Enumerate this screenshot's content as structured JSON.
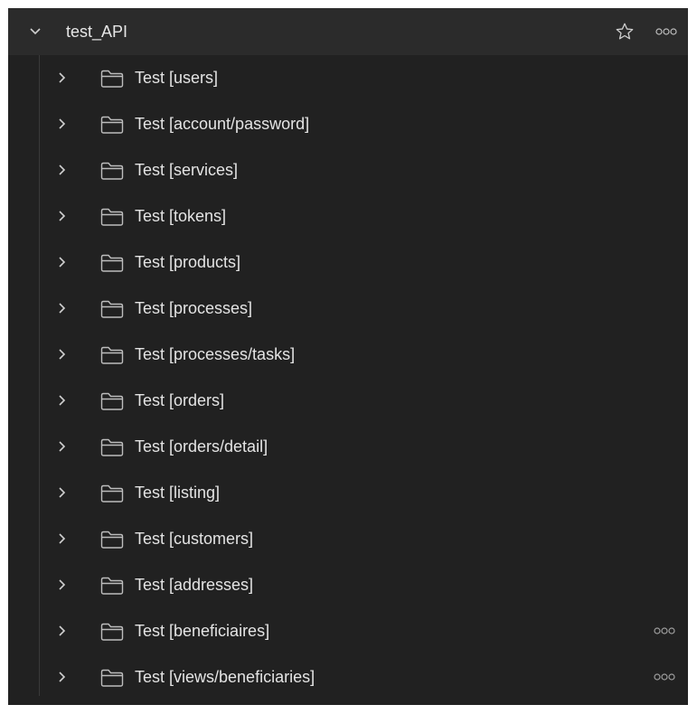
{
  "collection": {
    "title": "test_API",
    "icons": {
      "expand": "chevron-down-icon",
      "favorite": "star-icon",
      "more": "more-options-icon"
    }
  },
  "folders": [
    {
      "label": "Test [users]",
      "more": false
    },
    {
      "label": "Test [account/password]",
      "more": false
    },
    {
      "label": "Test [services]",
      "more": false
    },
    {
      "label": "Test [tokens]",
      "more": false
    },
    {
      "label": "Test [products]",
      "more": false
    },
    {
      "label": "Test [processes]",
      "more": false
    },
    {
      "label": "Test [processes/tasks]",
      "more": false
    },
    {
      "label": "Test [orders]",
      "more": false
    },
    {
      "label": "Test [orders/detail]",
      "more": false
    },
    {
      "label": "Test [listing]",
      "more": false
    },
    {
      "label": "Test [customers]",
      "more": false
    },
    {
      "label": "Test [addresses]",
      "more": false
    },
    {
      "label": "Test [beneficiaires]",
      "more": true
    },
    {
      "label": "Test [views/beneficiaries]",
      "more": true
    }
  ],
  "colors": {
    "panel_bg": "#212121",
    "header_bg": "#2b2b2b",
    "text": "#e4e4e4",
    "icon": "#bdbdbd"
  }
}
